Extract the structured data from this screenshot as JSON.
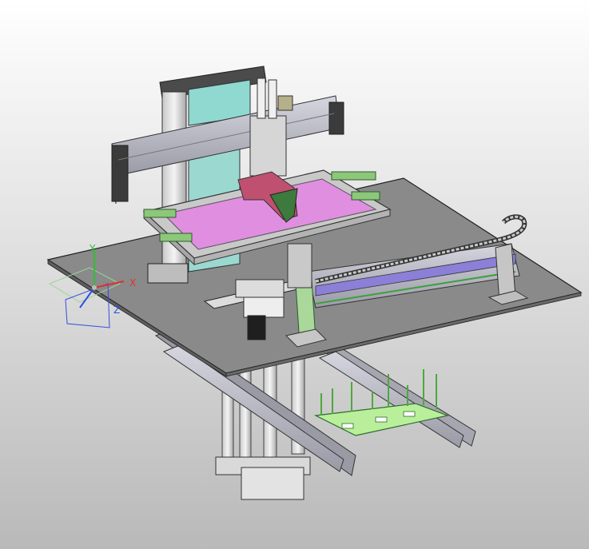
{
  "viewport": {
    "background_top": "#ffffff",
    "background_bottom": "#b9b9b9"
  },
  "triad": {
    "x_label": "X",
    "y_label": "Y",
    "z_label": "Z",
    "x_color": "#e03030",
    "y_color": "#30c030",
    "z_color": "#3050e0"
  },
  "model": {
    "plate_color": "#8a8a8a",
    "screen_color": "#e08ee0",
    "glass_color": "#8fd9d0",
    "gripper_color": "#c05070",
    "part_highlight_color": "#99e07a",
    "rail_color": "#b7b7c8",
    "slot_color": "#8c7fd8",
    "icons": [
      "coordinate-triad-icon"
    ]
  }
}
